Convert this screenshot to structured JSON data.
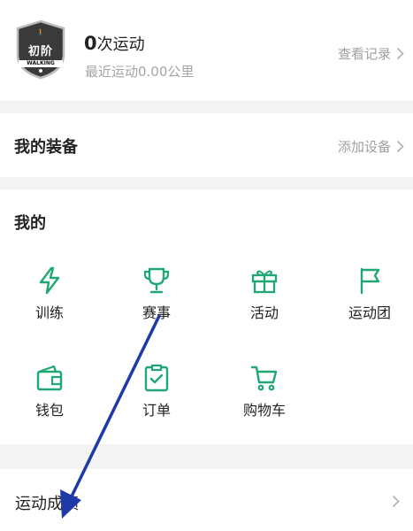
{
  "stats": {
    "badge_label": "初阶",
    "badge_sub": "WALKING",
    "count": "0",
    "count_suffix": "次运动",
    "recent_distance": "最近运动0.00公里",
    "view_records": "查看记录"
  },
  "equipment": {
    "title": "我的装备",
    "add_device": "添加设备"
  },
  "mine": {
    "title": "我的",
    "items": [
      {
        "label": "训练",
        "icon": "lightning-icon"
      },
      {
        "label": "赛事",
        "icon": "trophy-icon"
      },
      {
        "label": "活动",
        "icon": "gift-icon"
      },
      {
        "label": "运动团",
        "icon": "flag-icon"
      },
      {
        "label": "钱包",
        "icon": "wallet-icon"
      },
      {
        "label": "订单",
        "icon": "clipboard-check-icon"
      },
      {
        "label": "购物车",
        "icon": "shopping-cart-icon"
      }
    ]
  },
  "scores": {
    "title": "运动成绩"
  },
  "colors": {
    "accent_green": "#1fa874",
    "annotation_blue": "#1f3aa8"
  }
}
